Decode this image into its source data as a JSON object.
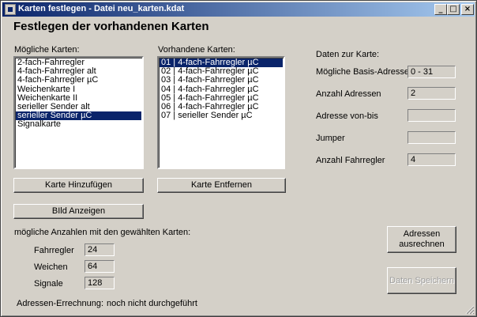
{
  "window": {
    "title": "Karten festlegen - Datei neu_karten.kdat",
    "controls": {
      "minimize": "_",
      "maximize": "□",
      "close": "×"
    }
  },
  "heading": "Festlegen der vorhandenen Karten",
  "available": {
    "label": "Mögliche Karten:",
    "items": [
      "2-fach-Fahrregler",
      "4-fach-Fahrregler alt",
      "4-fach-Fahrregler µC",
      "Weichenkarte I",
      "Weichenkarte II",
      "serieller Sender alt",
      "serieller Sender µC",
      "Signalkarte"
    ],
    "selected_index": 6
  },
  "existing": {
    "label": "Vorhandene Karten:",
    "items": [
      "01 | 4-fach-Fahrregler µC",
      "02 | 4-fach-Fahrregler µC",
      "03 | 4-fach-Fahrregler µC",
      "04 | 4-fach-Fahrregler µC",
      "05 | 4-fach-Fahrregler µC",
      "06 | 4-fach-Fahrregler µC",
      "07 | serieller Sender µC"
    ],
    "selected_index": 0
  },
  "card_info": {
    "heading": "Daten zur Karte:",
    "base_addresses_label": "Mögliche Basis-Adressen",
    "base_addresses_value": "0 - 31",
    "address_count_label": "Anzahl Adressen",
    "address_count_value": "2",
    "address_range_label": "Adresse von-bis",
    "address_range_value": "",
    "jumper_label": "Jumper",
    "jumper_value": "",
    "controller_count_label": "Anzahl Fahrregler",
    "controller_count_value": "4"
  },
  "buttons": {
    "add": "Karte Hinzufügen",
    "remove": "Karte Entfernen",
    "show_image": "BIld Anzeigen",
    "compute": "Adressen ausrechnen",
    "save": "Daten Speichern"
  },
  "counts": {
    "heading": "mögliche Anzahlen mit den gewählten Karten:",
    "controllers_label": "Fahrregler",
    "controllers_value": "24",
    "switches_label": "Weichen",
    "switches_value": "64",
    "signals_label": "Signale",
    "signals_value": "128"
  },
  "status": {
    "label": "Adressen-Errechnung:",
    "value": "noch nicht durchgeführt"
  },
  "colors": {
    "face": "#d4d0c8",
    "title_start": "#0a246a",
    "title_end": "#a6caf0",
    "selection": "#0a246a"
  }
}
